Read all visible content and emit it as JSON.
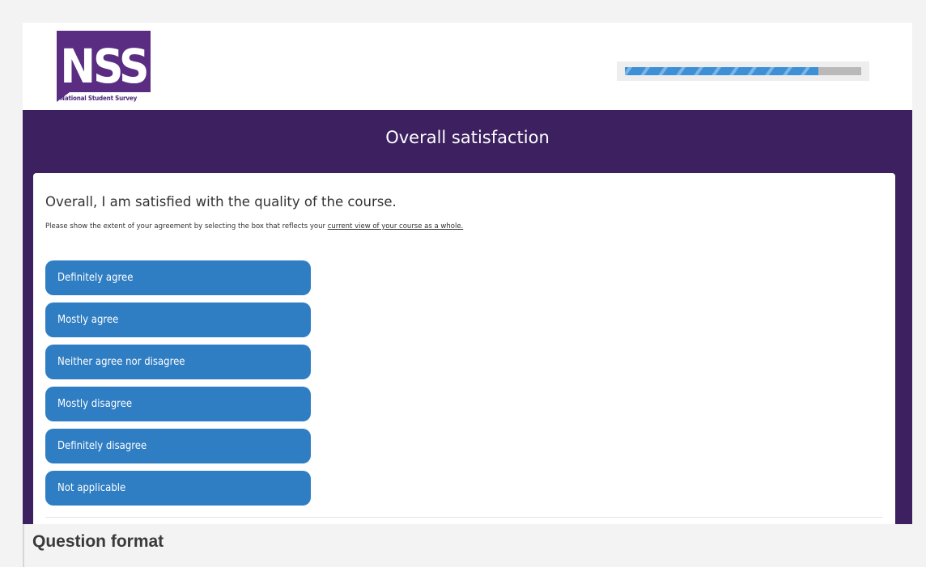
{
  "logo": {
    "mark": "NSS",
    "subtitle": "National Student Survey",
    "color": "#5a2d82"
  },
  "progress": {
    "fraction": 0.82
  },
  "section": {
    "title": "Overall satisfaction"
  },
  "question": {
    "text": "Overall, I am satisfied with the quality of the course.",
    "instruction_prefix": "Please show the extent of your agreement by selecting the box that reflects your ",
    "instruction_emphasis": "current view of your course as a whole."
  },
  "options": [
    "Definitely agree",
    "Mostly agree",
    "Neither agree nor disagree",
    "Mostly disagree",
    "Definitely disagree",
    "Not applicable"
  ],
  "caption": "Question format",
  "colors": {
    "banner": "#3c2060",
    "option_button": "#2f7dc2",
    "progress_fill": "#3d8fd6"
  }
}
